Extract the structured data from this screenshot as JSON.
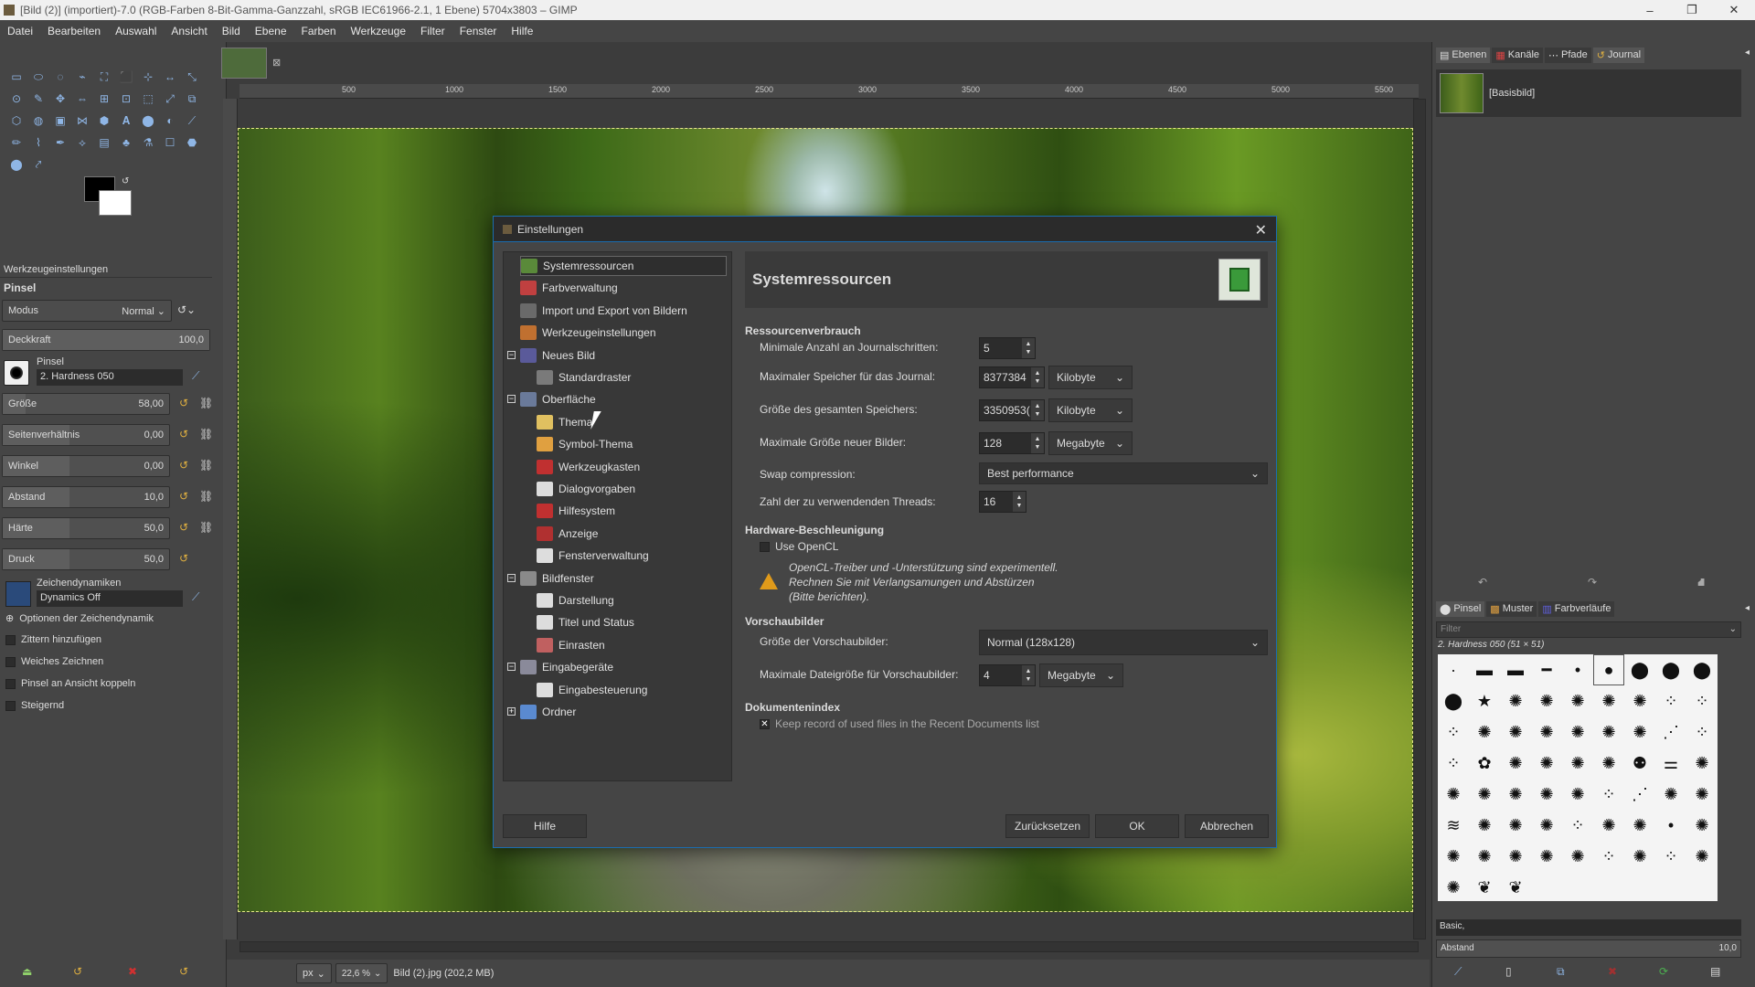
{
  "window": {
    "title": "[Bild (2)] (importiert)-7.0 (RGB-Farben 8-Bit-Gamma-Ganzzahl, sRGB IEC61966-2.1, 1 Ebene) 5704x3803 – GIMP",
    "min": "–",
    "max": "❐",
    "close": "✕"
  },
  "menu": [
    "Datei",
    "Bearbeiten",
    "Auswahl",
    "Ansicht",
    "Bild",
    "Ebene",
    "Farben",
    "Werkzeuge",
    "Filter",
    "Fenster",
    "Hilfe"
  ],
  "toolbox": {
    "tools": [
      "▭",
      "⬭",
      "◌",
      "⌁",
      "⛶",
      "⬛",
      "⊹",
      "↔",
      "⤡",
      "⊙",
      "✎",
      "✥",
      "⇔",
      "⊞",
      "⊡",
      "⬚",
      "⤢",
      "⧉",
      "⬡",
      "◍",
      "▣",
      "⋈",
      "⬢",
      "𝐀",
      "⬤",
      "◐",
      "⟋",
      "✏",
      "⌇",
      "✒",
      "⟡",
      "▤",
      "♣",
      "⚗",
      "☐",
      "⬣",
      "⬤",
      "⤤"
    ],
    "tab_label": "Werkzeugeinstellungen",
    "tool_name": "Pinsel",
    "mode_label": "Modus",
    "mode_value": "Normal",
    "opacity_label": "Deckkraft",
    "opacity_value": "100,0",
    "brush_label": "Pinsel",
    "brush_value": "2. Hardness 050",
    "size_label": "Größe",
    "size_value": "58,00",
    "ratio_label": "Seitenverhältnis",
    "ratio_value": "0,00",
    "angle_label": "Winkel",
    "angle_value": "0,00",
    "spacing_label": "Abstand",
    "spacing_value": "10,0",
    "hardness_label": "Härte",
    "hardness_value": "50,0",
    "pressure_label": "Druck",
    "pressure_value": "50,0",
    "dynamics_label": "Zeichendynamiken",
    "dynamics_value": "Dynamics Off",
    "checks": [
      "Optionen der Zeichendynamik",
      "Zittern hinzufügen",
      "Weiches Zeichnen",
      "Pinsel an Ansicht koppeln",
      "Steigernd"
    ]
  },
  "ruler": [
    "500",
    "1000",
    "1500",
    "2000",
    "2500",
    "3000",
    "3500",
    "4000",
    "4500",
    "5000",
    "5500"
  ],
  "status": {
    "unit": "px",
    "zoom": "22,6 %",
    "file": "Bild (2).jpg (202,2 MB)"
  },
  "dock": {
    "tabs": [
      "Ebenen",
      "Kanäle",
      "Pfade",
      "Journal"
    ],
    "layer_name": "[Basisbild]",
    "brush_tabs": [
      "Pinsel",
      "Muster",
      "Farbverläufe"
    ],
    "filter_placeholder": "Filter",
    "brush_info": "2. Hardness 050 (51 × 51)",
    "tag_value": "Basic,",
    "spacing_label": "Abstand",
    "spacing_value": "10,0"
  },
  "dialog": {
    "title": "Einstellungen",
    "close": "✕",
    "tree": [
      "Systemressourcen",
      "Farbverwaltung",
      "Import und Export von Bildern",
      "Werkzeugeinstellungen",
      "Neues Bild",
      "Standardraster",
      "Oberfläche",
      "Thema",
      "Symbol-Thema",
      "Werkzeugkasten",
      "Dialogvorgaben",
      "Hilfesystem",
      "Anzeige",
      "Fensterverwaltung",
      "Bildfenster",
      "Darstellung",
      "Titel und Status",
      "Einrasten",
      "Eingabegeräte",
      "Eingabesteuerung",
      "Ordner"
    ],
    "heading": "Systemressourcen",
    "sec_resources": "Ressourcenverbrauch",
    "min_undo_label": "Minimale Anzahl an Journalschritten:",
    "min_undo_value": "5",
    "max_undo_mem_label": "Maximaler Speicher für das Journal:",
    "max_undo_mem_value": "8377384",
    "max_undo_mem_unit": "Kilobyte",
    "cache_label": "Größe des gesamten Speichers:",
    "cache_value": "3350953(",
    "cache_unit": "Kilobyte",
    "max_new_label": "Maximale Größe neuer Bilder:",
    "max_new_value": "128",
    "max_new_unit": "Megabyte",
    "swap_label": "Swap compression:",
    "swap_value": "Best performance",
    "threads_label": "Zahl der zu verwendenden Threads:",
    "threads_value": "16",
    "sec_hw": "Hardware-Beschleunigung",
    "opencl_label": "Use OpenCL",
    "opencl_warning": [
      "OpenCL-Treiber und -Unterstützung sind experimentell.",
      "Rechnen Sie mit Verlangsamungen und Abstürzen",
      "(Bitte berichten)."
    ],
    "sec_thumbs": "Vorschaubilder",
    "thumb_size_label": "Größe der Vorschaubilder:",
    "thumb_size_value": "Normal (128x128)",
    "thumb_max_label": "Maximale Dateigröße für Vorschaubilder:",
    "thumb_max_value": "4",
    "thumb_max_unit": "Megabyte",
    "sec_docs": "Dokumentenindex",
    "recent_label": "Keep record of used files in the Recent Documents list",
    "btn_help": "Hilfe",
    "btn_reset": "Zurücksetzen",
    "btn_ok": "OK",
    "btn_cancel": "Abbrechen"
  }
}
